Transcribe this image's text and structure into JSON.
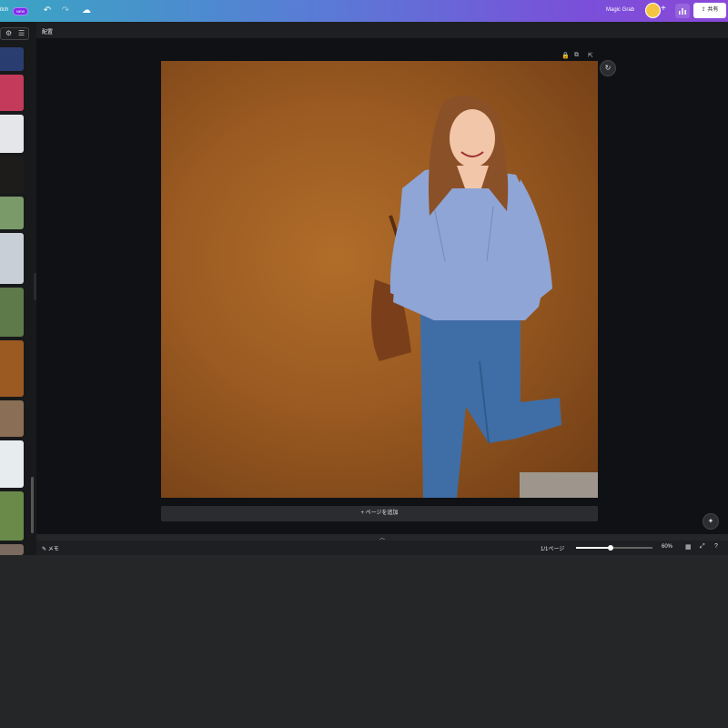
{
  "topbar": {
    "brand_fragment": "itch",
    "new_badge": "NEW",
    "magic_grab": "Magic Grab",
    "share_label": "共有",
    "icons": {
      "undo": "undo-icon",
      "redo": "redo-icon",
      "cloud": "cloud-save-icon",
      "plus": "plus-icon",
      "stats": "bar-chart-icon",
      "share": "share-icon"
    }
  },
  "secondary_bar": {
    "position_label": "配置"
  },
  "canvas": {
    "add_page_label": "+ ページを追加"
  },
  "bottombar": {
    "notes_label": "メモ",
    "page_indicator": "1/1ページ",
    "zoom_label": "60%",
    "zoom_fraction": 0.45
  },
  "thumbnails": [
    {
      "color": "#2a3d70"
    },
    {
      "color": "#c43a5a"
    },
    {
      "color": "#e4e6ea"
    },
    {
      "color": "#1d1c1a"
    },
    {
      "color": "#7a9a6a"
    },
    {
      "color": "#c9cfd6"
    },
    {
      "color": "#5e7a4a"
    },
    {
      "color": "#9a5a22"
    },
    {
      "color": "#8a6e55"
    },
    {
      "color": "#e7ecef"
    },
    {
      "color": "#6a8a4a"
    },
    {
      "color": "#7a6a60"
    }
  ],
  "colors": {
    "accent": "#7d2ae8",
    "canvas_bg": "#0f1115",
    "photo_wall": "#9a5a21"
  }
}
